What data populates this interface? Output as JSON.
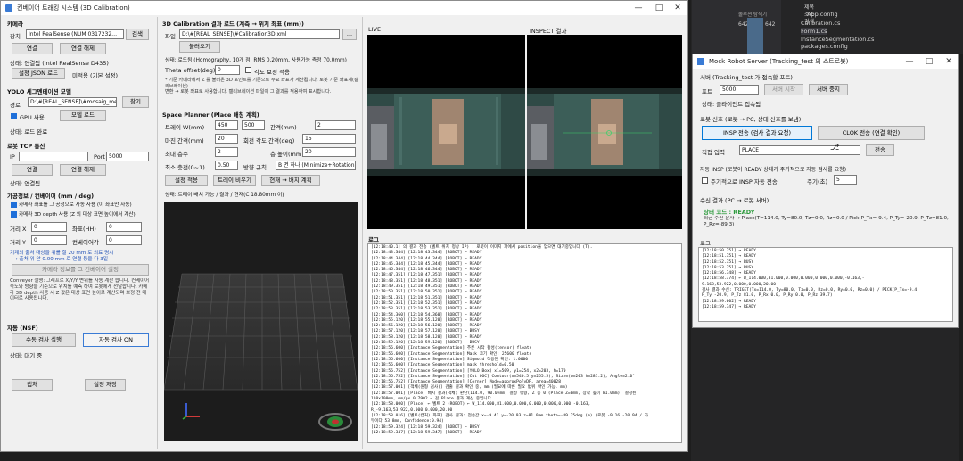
{
  "ide": {
    "top_labels": [
      "제목",
      "소스",
      "검색"
    ],
    "tree": [
      "App.config",
      "Calibration.cs",
      "Form1.cs",
      "InstanceSegmentation.cs",
      "packages.config",
      "Program.cs"
    ],
    "mini_left": "642",
    "mini_right": "642",
    "mini_hint": "솔루션 탐색기"
  },
  "main": {
    "title": "컨베이어 트래킹 시스템 (3D Calibration)",
    "camera": {
      "header": "카메라",
      "device_label": "장치",
      "device_value": "Intel RealSense (NUM 0317232…",
      "search_btn": "검색",
      "connect_btn": "연결",
      "disconnect_btn": "연결 해제",
      "status_text": "상태: 연결됨 (Intel RealSense D435)",
      "json_btn": "설정 JSON 로드",
      "json_note": "미적용 (기본 설정)"
    },
    "yolo": {
      "header": "YOLO 세그멘테이션 모델",
      "path_label": "경로",
      "path_value": "D:\\#[REAL_SENSE]\\#mosaig_meta…",
      "browse_btn": "찾기",
      "gpu_label": "GPU 사용",
      "load_btn": "모델 로드",
      "status_text": "상태: 로드 완료"
    },
    "robot_tcp": {
      "header": "로봇 TCP 통신",
      "ip_label": "IP",
      "ip_value": "",
      "port_label": "Port",
      "port_value": "5000",
      "connect_btn": "연결",
      "disconnect_btn": "연결 해제",
      "status_text": "상태: 연결됨"
    },
    "conveyor": {
      "header": "가공정보 / 컨베이어 (mm / deg)",
      "check1": "카메라 좌표를 그 공정으로 자동 사용 (이 좌표만 자동)",
      "check2": "카메라 3D depth 사용 (Z 의 대상 표면 높이에서 계산)",
      "fields": [
        {
          "label": "거리 X",
          "value": "0"
        },
        {
          "label": "좌표(HH)",
          "value": "0"
        },
        {
          "label": "거리 Y",
          "value": "0"
        },
        {
          "label": "컨베이어각",
          "value": "0"
        }
      ],
      "hint": "기계의 출처 대상을 위를 잘 20 mm 로 의료 명시",
      "hint2": "→ 출처 위 안 0.00 mm 로 연결 등을 다 3일",
      "apply_btn": "카메라 정보를 그 컨베이어 설정",
      "desc": "Conveyor 설명: 그래프로 X/Y/Y 변위를 자동 계산 합니다. 컨베이어 속도와 방향을 기준으로 위치를 예측 하여 로봇에게 전달합니다. 카메라 3D depth 사용 시 Z 값은 대상 표면 높이로 계산되며 보정 전 데이터로 사용됩니다."
    },
    "auto_section": {
      "header": "자동 (NSF)",
      "auto_btn": "수동 검사 실행",
      "auto_on_btn": "자동 검사 ON",
      "status_text": "상태: 대기 중"
    },
    "bottom": {
      "capture_btn": "캡처",
      "save_btn": "설정 저장"
    },
    "calib": {
      "header": "3D Calibration 결과 로드 (계측 → 위치 좌표 (mm))",
      "file_label": "파일",
      "file_value": "D:\\#[REAL_SENSE]\\#Calibration3D.xml",
      "browse_btn": "...",
      "load_btn": "불러오기",
      "status_text": "상태: 로드됨 (Homography, 10개 점, RMS 0.20mm, 사용가능 측정 70.0mm)",
      "theta_label": "Theta offset(deg)",
      "theta_value": "0",
      "theta_check": "각도 보정 적용",
      "note1": "* 기준 카메라에서 Z 를 불러온 3D 포인트를 기준으로 주요 좌표가 계산됩니다. 로봇 기준 좌표계(캘리브레이션)",
      "note2": "변환 → 로봇 좌표로 사용합니다. 캘리브레이션 파일이 그 결과를 적용하여 표시합니다."
    },
    "place": {
      "header": "Space Planner (Place 매칭 계획)",
      "rows": [
        {
          "l1": "트레이 W(mm)",
          "v1": "450",
          "v2": "500",
          "l2": "간격(mm)",
          "v3": "2"
        },
        {
          "l1": "마진 간격(mm)",
          "v1": "20",
          "l2": "회전 각도 간격(deg)",
          "v3": "15"
        },
        {
          "l1": "최대 층수",
          "v1": "2",
          "l2": "층 높이(mm)",
          "v3": "20"
        },
        {
          "l1": "최소 충전(0~1)",
          "v1": "0.50",
          "l2": "방향 규칙",
          "v3": "B 면 하나 (Minimize+Rotation)"
        }
      ],
      "btns": [
        "설정 적용",
        "트레이 비우기",
        "현재 → 배치 계획"
      ],
      "status_text": "상태: 트레이 배치 가능 / 결과 / 현재(C 18.80mm 이)"
    },
    "view3d": {
      "label": "3D View"
    },
    "cams": {
      "live_label": "LIVE",
      "inspect_label": "INSPECT 결과"
    },
    "log": {
      "header": "로그",
      "lines": [
        "[12:18:40.1]  의 결과 전송 (벨트 위치 정상 IP) : 로봇이 이미지 파에서 position을 얻으면 대기중입니다 (T).",
        "[12:18:43.344]  [12:18:43.344]  [ROBOT] ← READY",
        "[12:18:44.344]  [12:18:44.344]  [ROBOT] ← READY",
        "[12:18:45.344]  [12:18:45.344]  [ROBOT] ← READY",
        "[12:18:46.344]  [12:18:46.344]  [ROBOT] ← READY",
        "[12:18:47.351]  [12:18:47.351]  [ROBOT] ← READY",
        "[12:18:48.351]  [12:18:48.351]  [ROBOT] ← READY",
        "[12:18:49.351]  [12:18:49.351]  [ROBOT] ← READY",
        "[12:18:50.351]  [12:18:50.351]  [ROBOT] ← READY",
        "[12:18:51.351]  [12:18:51.351]  [ROBOT] ← READY",
        "[12:18:52.351]  [12:18:52.351]  [ROBOT] ← READY",
        "[12:18:53.351]  [12:18:53.351]  [ROBOT] ← READY",
        "[12:18:54.360]  [12:18:54.360]  [ROBOT] ← READY",
        "[12:18:55.120]  [12:18:55.120]  [ROBOT] ← READY",
        "[12:18:56.120]  [12:18:56.120]  [ROBOT] ← READY",
        "[12:18:57.120]  [12:18:57.120]  [ROBOT] ← BUSY",
        "[12:18:58.120]  [12:18:58.120]  [ROBOT] ← READY",
        "[12:18:59.120]  [12:18:59.120]  [ROBOT] ← BUSY",
        "[12:18:56.600]  [Instance Segmentation] 추론 시작 활성(tensor) floats",
        "[12:18:56.600]  [Instance Segmentation] Mask 크기 확인: 25600 floats",
        "[12:18:56.600]  [Instance Segmentation] Sigmoid 적용된 확인: 1.0000",
        "[12:18:56.600]  [Instance Segmentation] mask threshold=0.50",
        "[12:18:56.752]  [Instance Segmentation] [YOLO Box] x1=509, y1=254, x2=203, h=170",
        "[12:18:56.752]  [Instance Segmentation] [Cut OOC] Contour(x=540.5 y=255.5), Size=(w=203 h=281.2), Angle=2.0°",
        "[12:18:56.752]  [Instance Segmentation] [Corner] Mode=approxPolyDP, area=40028",
        "[12:18:57.001]  [객체(원형 검사)] 검출 결과 확인 중, mm (필요에 따른 필요 범위 확인 가능, mm)",
        "[12:18:57.001]  [Place] 배치 결과(객체) 판단(114.0, 90.0)mm, 결정 유형, Z 층 0 (Place Z=0mm, 장착 높이 81.0mm), 결정된",
        "               110x100mm, mm/px 0.7902 → 검 Place 결과 계산 중입니다.",
        "[12:18:58.000]  [Place] ← 벨트 2 (ROBOT) ← W_114.000,81.000,0.000,0.000,0.000,0.000,-0.163,",
        "               R_-9.163,53.922,0.000,0.000,20.00",
        "[12:18:58.016]  [벨트(캡처) 좌표] 검사 결과: 전송값 x=-9.41 y=-20.93 z=81.0mm theta=-89.25deg (m) (로봇 -9.16,-20.94 / 자",
        "               부이다 53.8mm, Confidence:0.94)",
        "[12:18:59.324]  [12:18:59.324]  [ROBOT] ← BUSY",
        "[12:18:59.347]  [12:18:59.347]  [ROBOT] ← READY"
      ]
    }
  },
  "mock": {
    "title": "Mock Robot Server (Tracking_test 의 스트로봇)",
    "server_header": "서버 (Tracking_test 가 접속할 포트)",
    "port_label": "포트",
    "port_value": "5000",
    "start_btn": "서버 시작",
    "stop_btn": "서버 중지",
    "status_text": "상태: 클라이언트 접속됨",
    "send_header": "로봇 신호 (로봇 → PC, 상태 신호를 보냄)",
    "insp_btn": "INSP 전송 (검사 결과 요청)",
    "clok_btn": "CLOK 전송 (연결 확인)",
    "cmd_label": "직접 입력",
    "cmd_value": "PLACE",
    "send_btn": "전송",
    "auto_header": "자동 INSP (로봇이 READY 상태가 주기적으로 자동 검사를 요청)",
    "auto_check": "주기적으로 INSP 자동 전송",
    "period_label": "주기(초)",
    "period_value": "5",
    "recv_header": "수신 결과 (PC → 로봇 서버)",
    "recv_state": "상태 코드 : READY",
    "recv_line": "최근 수신 문자 → Place(T=114.0, Ty=80.0, Tz=0.0, Rz=0.0 / Pick(P_Tx=-9.4, P_Ty=-20.9, P_Tz=81.0, P_Rz=-89.3)",
    "log_header": "로그",
    "log_lines": [
      "[12:18:50.351] → READY",
      "[12:18:51.351] → READY",
      "[12:18:52.351] → BUSY",
      "[12:18:53.351] → BUSY",
      "[12:18:56.348] → READY",
      "[12:18:58.374] ← W_114.000,81.000,0.000,0.000,0.000,0.000,-0.163,-",
      "  9.163,53.922,0.000,0.000,20.00",
      "  검사 결과 수신: TRIGET(Tx=114.0, Ty=80.0, Tz=0.0, Rz=0.0, Ry=0.0, Rz=0.0) / PICK(P_Tx=-9.4,",
      "  P_Ty -20.9, P_Tz 81.0, P_Rx 0.0, P_Ry 0.0, P_Rz 39.7)",
      "[12:18:59.002] → READY",
      "[12:18:59.347] → READY"
    ]
  }
}
